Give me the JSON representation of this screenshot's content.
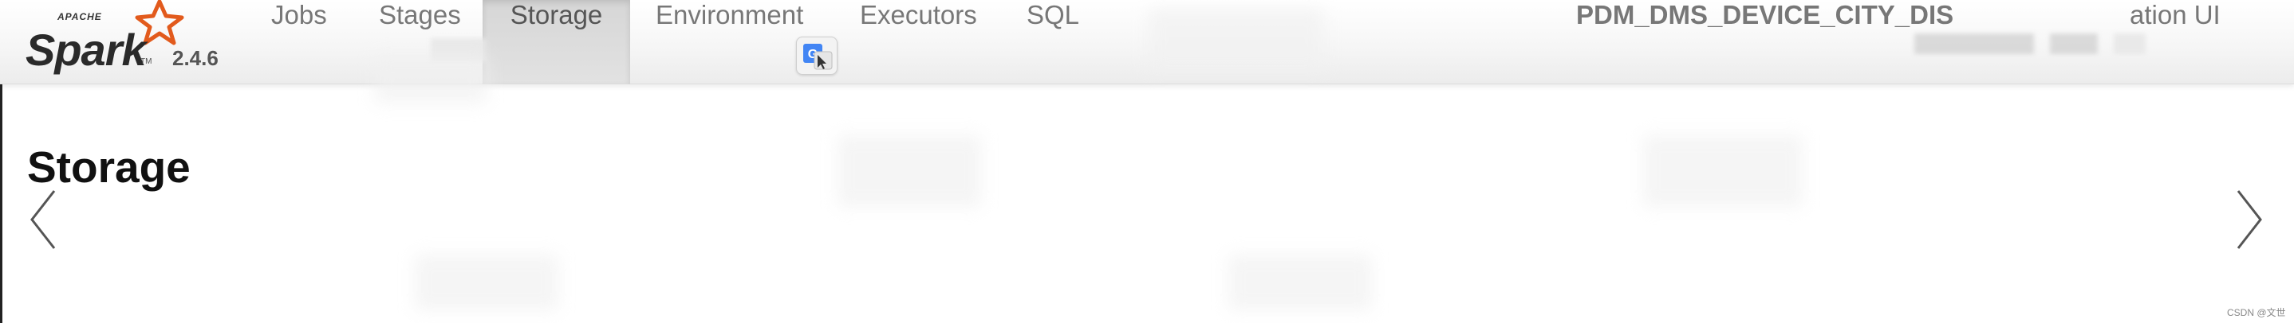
{
  "brand": {
    "apache": "APACHE",
    "name": "Spark",
    "tm": "TM",
    "version": "2.4.6"
  },
  "nav": {
    "tabs": [
      {
        "label": "Jobs",
        "active": false
      },
      {
        "label": "Stages",
        "active": false
      },
      {
        "label": "Storage",
        "active": true
      },
      {
        "label": "Environment",
        "active": false
      },
      {
        "label": "Executors",
        "active": false
      },
      {
        "label": "SQL",
        "active": false
      }
    ],
    "app_name": "PDM_DMS_DEVICE_CITY_DIS",
    "app_name_suffix": "ation UI"
  },
  "translate_icon": "google-translate-icon",
  "page": {
    "title": "Storage"
  },
  "carousel": {
    "prev_icon": "chevron-left-icon",
    "next_icon": "chevron-right-icon"
  },
  "watermark": "CSDN @文世",
  "colors": {
    "navbar_top": "#ffffff",
    "navbar_bottom": "#ececec",
    "active_tab": "#d9d9d9",
    "nav_text": "#777777",
    "title_text": "#111111",
    "translate_blue": "#4285f4"
  }
}
